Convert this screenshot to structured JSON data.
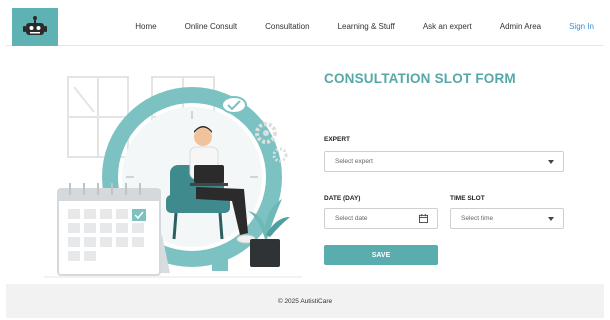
{
  "brand": {
    "accent": "#5fb2b4",
    "logo_icon": "robot-icon"
  },
  "nav": {
    "items": [
      {
        "label": "Home"
      },
      {
        "label": "Online Consult"
      },
      {
        "label": "Consultation"
      },
      {
        "label": "Learning & Stuff"
      },
      {
        "label": "Ask an expert"
      },
      {
        "label": "Admin Area"
      }
    ],
    "signin": "Sign In"
  },
  "form": {
    "title": "CONSULTATION SLOT FORM",
    "expert": {
      "label": "EXPERT",
      "placeholder": "Select expert"
    },
    "date": {
      "label": "DATE (DAY)",
      "placeholder": "Select date"
    },
    "slot": {
      "label": "TIME SLOT",
      "placeholder": "Select time"
    },
    "save": "SAVE"
  },
  "footer": {
    "text": "© 2025 AutistiCare"
  }
}
